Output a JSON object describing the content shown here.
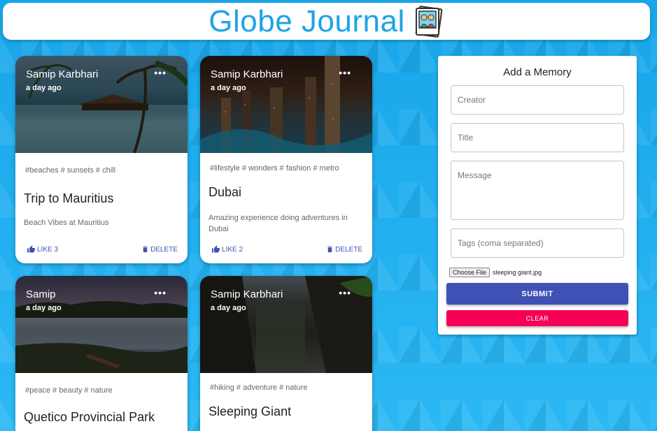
{
  "header": {
    "title": "Globe Journal",
    "logo_icon": "photo-album-icon"
  },
  "posts": [
    {
      "creator": "Samip Karbhari",
      "time_ago": "a day ago",
      "tags": "#beaches # sunsets # chill",
      "title": "Trip to Mauritius",
      "message": "Beach Vibes at Mauritius",
      "like_label": "LIKE 3",
      "delete_label": "DELETE",
      "more_label": "•••"
    },
    {
      "creator": "Samip Karbhari",
      "time_ago": "a day ago",
      "tags": "#lifestyle # wonders # fashion # metro",
      "title": "Dubai",
      "message": "Amazing experience doing adventures in Dubai",
      "like_label": "LIKE 2",
      "delete_label": "DELETE",
      "more_label": "•••"
    },
    {
      "creator": "Samip",
      "time_ago": "a day ago",
      "tags": "#peace # beauty # nature",
      "title": "Quetico Provincial Park",
      "more_label": "•••"
    },
    {
      "creator": "Samip Karbhari",
      "time_ago": "a day ago",
      "tags": "#hiking # adventure # nature",
      "title": "Sleeping Giant",
      "more_label": "•••"
    }
  ],
  "form": {
    "title": "Add a Memory",
    "creator_placeholder": "Creator",
    "title_placeholder": "Title",
    "message_placeholder": "Message",
    "tags_placeholder": "Tags (coma separated)",
    "file_button": "Choose File",
    "file_name": "sleeping giant.jpg",
    "submit_label": "SUBMIT",
    "clear_label": "CLEAR"
  },
  "colors": {
    "accent": "#3f51b5",
    "secondary": "#f50057",
    "title_blue": "#1ea3e6"
  }
}
